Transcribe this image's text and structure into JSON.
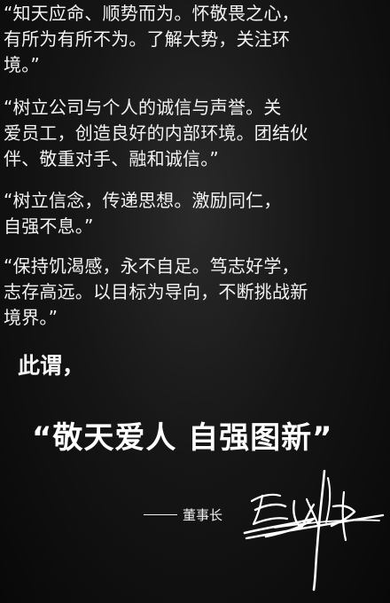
{
  "paragraphs": [
    [
      "“知天应命、顺势而为。怀敬畏之心，",
      "有所为有所不为。了解大势，关注环",
      "境。”"
    ],
    [
      "“树立公司与个人的诚信与声誉。关",
      "爱员工，创造良好的内部环境。团结伙",
      "伴、敬重对手、融和诚信。”"
    ],
    [
      "“树立信念，传递思想。激励同仁，",
      "自强不息。”"
    ],
    [
      "“保持饥渴感，永不自足。笃志好学，",
      "志存高远。以目标为导向，不断挑战新",
      "境界。”"
    ]
  ],
  "intro": "此谓，",
  "motto": "“敬天爱人  自强图新”",
  "signature_title": "董事长",
  "icons": {
    "signature": "handwritten-signature"
  }
}
